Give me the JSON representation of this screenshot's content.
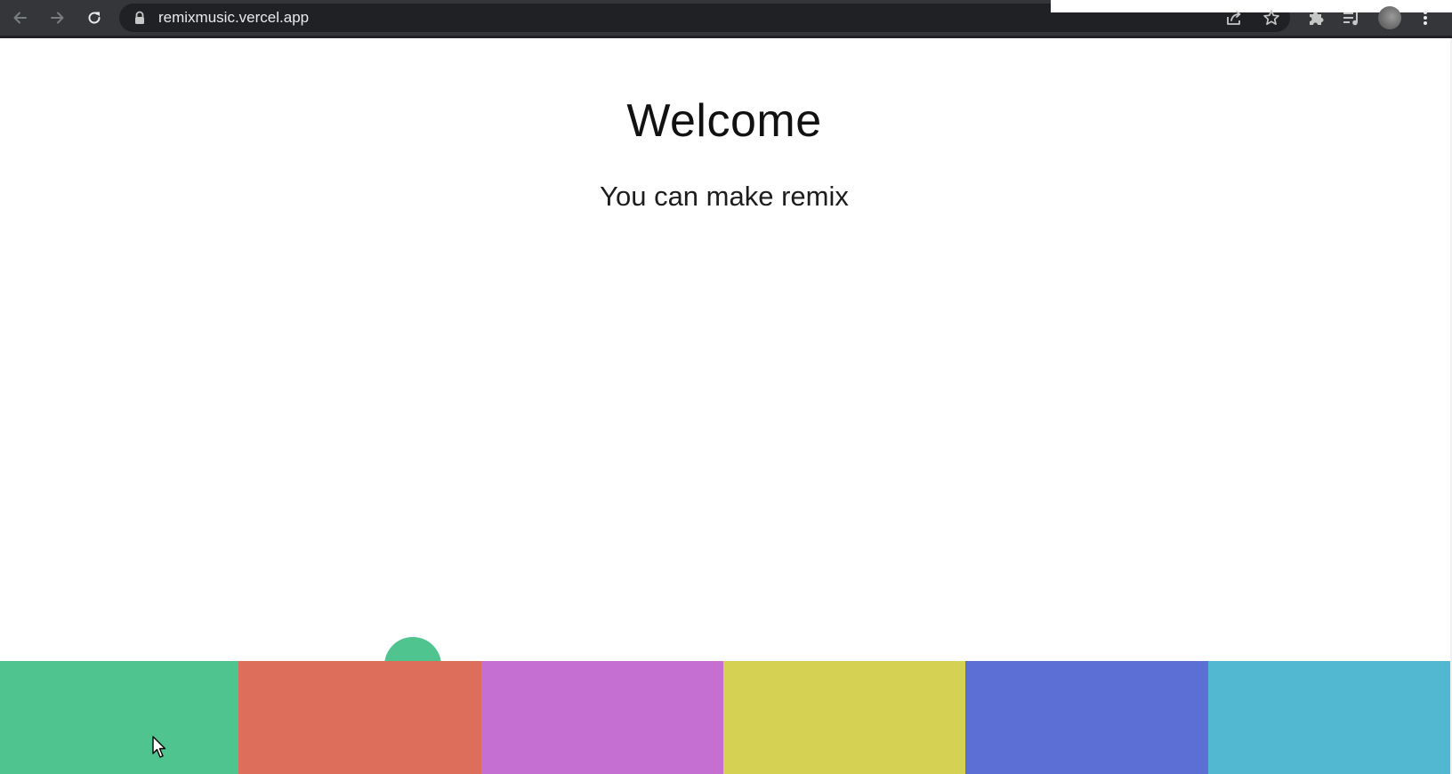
{
  "browser": {
    "url": "remixmusic.vercel.app",
    "icons": {
      "back": "arrow-left-icon",
      "forward": "arrow-right-icon",
      "reload": "reload-icon",
      "lock": "lock-icon",
      "share": "share-icon",
      "bookmark": "star-icon",
      "extensions": "puzzle-icon",
      "media": "media-queue-icon",
      "menu": "kebab-menu-icon"
    },
    "colors": {
      "toolbar": "#35363a",
      "omnibox": "#202124",
      "icon": "#c4c7c5"
    }
  },
  "page": {
    "title": "Welcome",
    "subtitle": "You can make remix",
    "background": "#ffffff",
    "bubble_color": "#4fc48f",
    "pads": [
      {
        "color": "#4fc48f"
      },
      {
        "color": "#dd6e5b"
      },
      {
        "color": "#c66fd2"
      },
      {
        "color": "#d5d153"
      },
      {
        "color": "#5b6fd4"
      },
      {
        "color": "#52b8d1"
      }
    ]
  }
}
